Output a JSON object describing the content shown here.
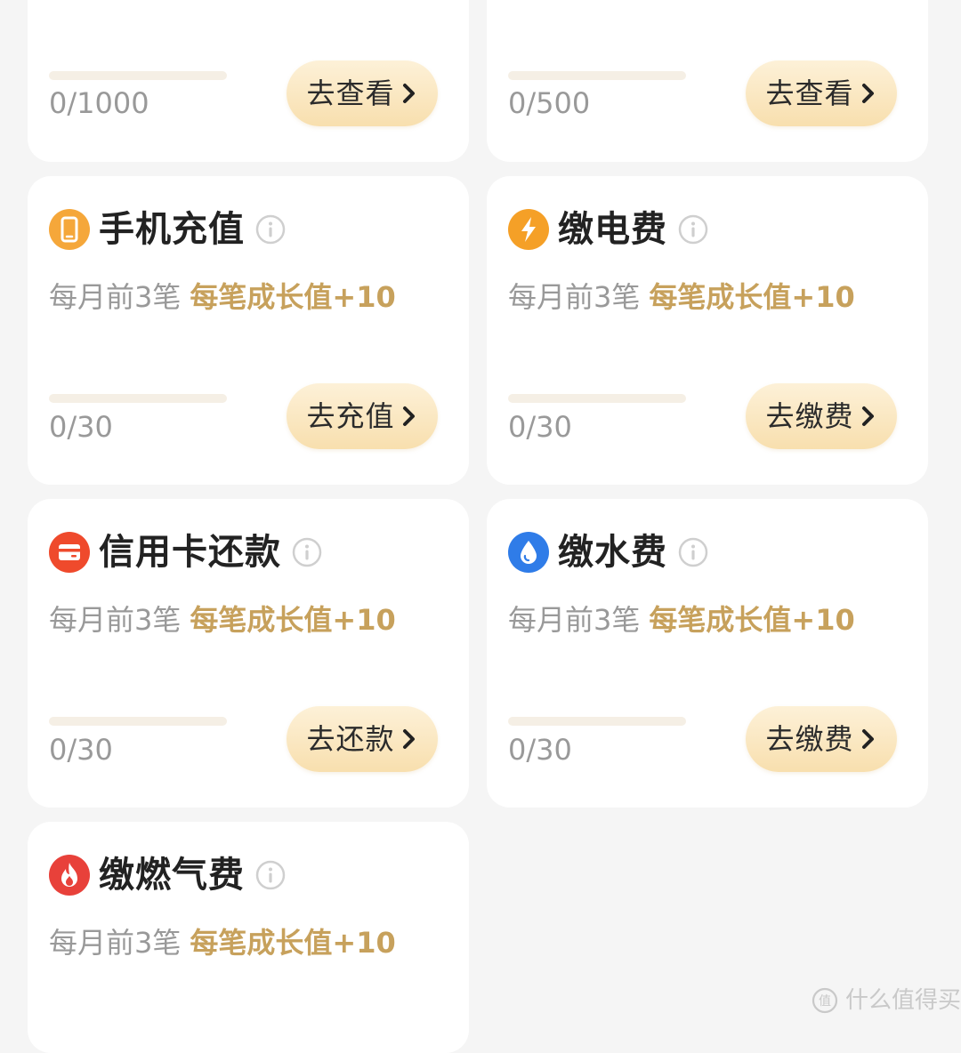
{
  "top_cards": [
    {
      "progress_text": "0/1000",
      "progress_value": 0,
      "action_label": "去查看"
    },
    {
      "progress_text": "0/500",
      "progress_value": 0,
      "action_label": "去查看"
    }
  ],
  "tasks": [
    {
      "title": "手机充值",
      "icon": "phone-icon",
      "icon_color": "#f5a73a",
      "limit": "每月前3笔",
      "reward": "每笔成长值+10",
      "progress_text": "0/30",
      "progress_value": 0,
      "action_label": "去充值"
    },
    {
      "title": "缴电费",
      "icon": "lightning-icon",
      "icon_color": "#f5a027",
      "limit": "每月前3笔",
      "reward": "每笔成长值+10",
      "progress_text": "0/30",
      "progress_value": 0,
      "action_label": "去缴费"
    },
    {
      "title": "信用卡还款",
      "icon": "credit-card-icon",
      "icon_color": "#ef4a2c",
      "limit": "每月前3笔",
      "reward": "每笔成长值+10",
      "progress_text": "0/30",
      "progress_value": 0,
      "action_label": "去还款"
    },
    {
      "title": "缴水费",
      "icon": "water-drop-icon",
      "icon_color": "#2f7ce8",
      "limit": "每月前3笔",
      "reward": "每笔成长值+10",
      "progress_text": "0/30",
      "progress_value": 0,
      "action_label": "去缴费"
    },
    {
      "title": "缴燃气费",
      "icon": "flame-icon",
      "icon_color": "#e8413a",
      "limit": "每月前3笔",
      "reward": "每笔成长值+10"
    }
  ],
  "watermark": {
    "text": "什么值得买"
  },
  "colors": {
    "page_background": "#f5f5f5",
    "card_background": "#ffffff",
    "reward_text": "#c7a15c",
    "secondary_text": "#999999",
    "title_text": "#222222",
    "button_gradient_top": "#fdf1d8",
    "button_gradient_bottom": "#f8dfae",
    "progress_track": "#f5efe5"
  }
}
